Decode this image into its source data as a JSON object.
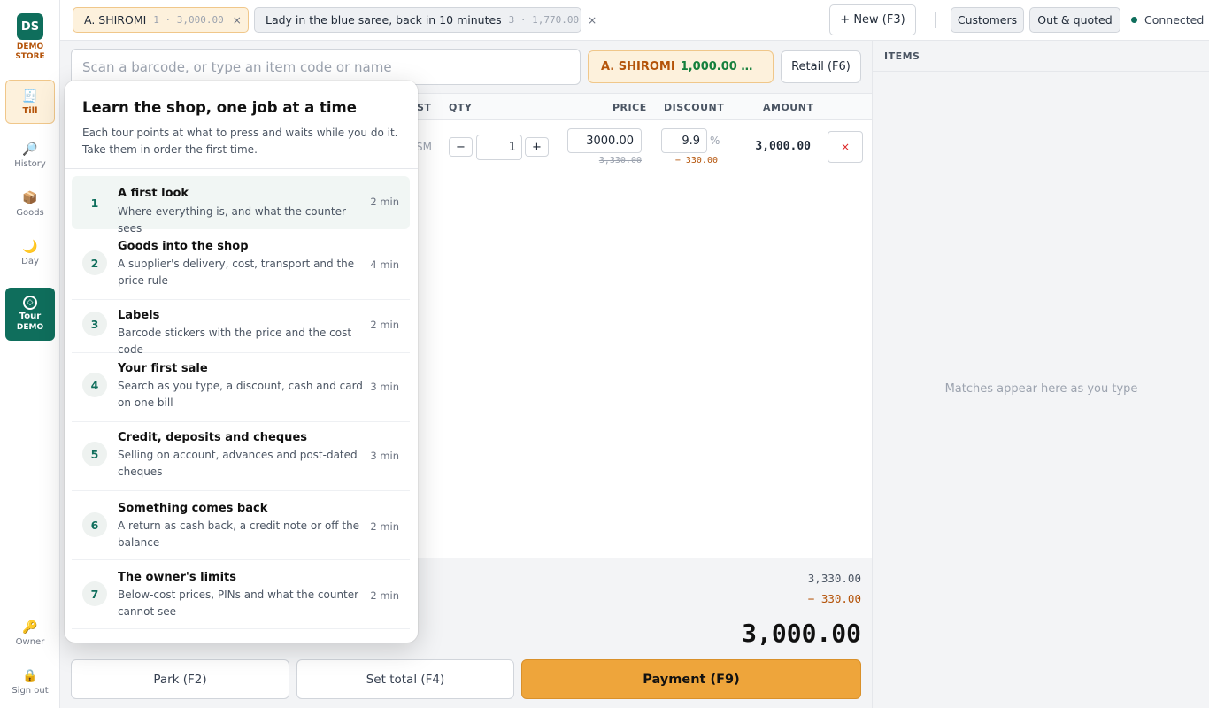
{
  "rail": {
    "logo": "DS",
    "store_name": "DEMO STORE",
    "nav": [
      {
        "label": "Till",
        "icon": "receipt-icon"
      },
      {
        "label": "History",
        "icon": "magnifier-icon"
      },
      {
        "label": "Goods",
        "icon": "box-icon"
      },
      {
        "label": "Day",
        "icon": "moon-icon"
      }
    ],
    "tour_label": "Tour",
    "tour_sub": "DEMO",
    "owner_label": "Owner",
    "signout_label": "Sign out"
  },
  "topbar": {
    "tabs": [
      {
        "name": "A. SHIROMI",
        "meta": "1 · 3,000.00",
        "active": true
      },
      {
        "name": "Lady in the blue saree, back in 10 minutes",
        "meta": "3 · 1,770.00",
        "active": false
      }
    ],
    "new_label": "+ New (F3)",
    "customers_label": "Customers",
    "out_quoted_label": "Out & quoted",
    "status": "Connected"
  },
  "main": {
    "search_placeholder": "Scan a barcode, or type an item code or name",
    "customer_name": "A. SHIROMI",
    "customer_balance": "1,000.00 wit...",
    "retail_label": "Retail (F6)",
    "columns": {
      "list": "ST",
      "qty": "QTY",
      "price": "PRICE",
      "discount": "DISCOUNT",
      "amount": "AMOUNT"
    },
    "line": {
      "code_tail": "SM",
      "qty": "1",
      "price": "3000.00",
      "price_original": "3,330.00",
      "discount": "9.9",
      "discount_unit": "%",
      "discount_amount": "− 330.00",
      "amount": "3,000.00"
    },
    "subtotal": "3,330.00",
    "discount_total": "− 330.00",
    "grand_total": "3,000.00",
    "park_label": "Park (F2)",
    "set_total_label": "Set total (F4)",
    "payment_label": "Payment (F9)"
  },
  "side": {
    "header": "ITEMS",
    "empty": "Matches appear here as you type"
  },
  "tour": {
    "title": "Learn the shop, one job at a time",
    "description": "Each tour points at what to press and waits while you do it. Take them in order the first time.",
    "steps": [
      {
        "num": "1",
        "title": "A first look",
        "desc": "Where everything is, and what the counter sees",
        "duration": "2 min"
      },
      {
        "num": "2",
        "title": "Goods into the shop",
        "desc": "A supplier's delivery, cost, transport and the price rule",
        "duration": "4 min"
      },
      {
        "num": "3",
        "title": "Labels",
        "desc": "Barcode stickers with the price and the cost code",
        "duration": "2 min"
      },
      {
        "num": "4",
        "title": "Your first sale",
        "desc": "Search as you type, a discount, cash and card on one bill",
        "duration": "3 min"
      },
      {
        "num": "5",
        "title": "Credit, deposits and cheques",
        "desc": "Selling on account, advances and post-dated cheques",
        "duration": "3 min"
      },
      {
        "num": "6",
        "title": "Something comes back",
        "desc": "A return as cash back, a credit note or off the balance",
        "duration": "2 min"
      },
      {
        "num": "7",
        "title": "The owner's limits",
        "desc": "Below-cost prices, PINs and what the counter cannot see",
        "duration": "2 min"
      }
    ]
  },
  "colors": {
    "brand": "#0f6e5c",
    "accent": "#eea53b",
    "warning_text": "#b45309"
  }
}
